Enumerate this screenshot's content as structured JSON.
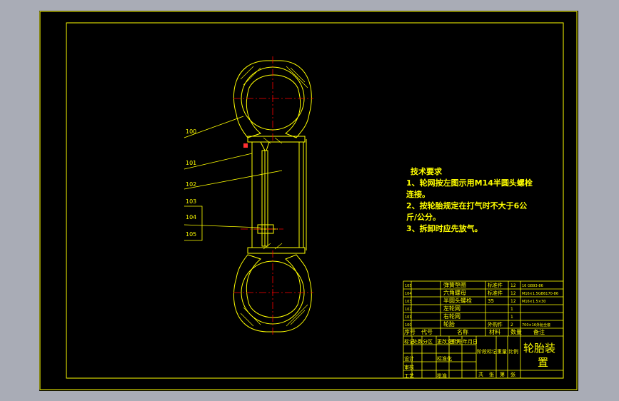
{
  "balloons": [
    "100",
    "101",
    "102",
    "103",
    "104",
    "105"
  ],
  "notes": {
    "title": "技术要求",
    "line1": "1、轮网按左图示用M14半圆头螺栓",
    "line2": "连接。",
    "line3": "2、按轮胎规定在打气时不大于6公",
    "line4": "斤/公分。",
    "line5": "3、拆卸时应先放气。"
  },
  "bom_rows": [
    {
      "no": "105",
      "name": "弹簧垫圈",
      "type": "标准件",
      "qty": "12",
      "spec": "16 GB93-86"
    },
    {
      "no": "104",
      "name": "六角螺母",
      "type": "标准件",
      "qty": "12",
      "spec": "M16×1.5GB6170-86"
    },
    {
      "no": "103",
      "name": "半圆头螺栓",
      "type": "35",
      "qty": "12",
      "spec": "M16×1.5×30"
    },
    {
      "no": "102",
      "name": "左轮网",
      "type": "",
      "qty": "1",
      "spec": ""
    },
    {
      "no": "101",
      "name": "右轮网",
      "type": "",
      "qty": "1",
      "spec": ""
    },
    {
      "no": "100",
      "name": "轮胎",
      "type": "外购件",
      "qty": "2",
      "spec": "700×16外胎全套"
    }
  ],
  "bom_header": {
    "no": "序号",
    "code": "代号",
    "name": "名称",
    "material": "材料",
    "qty": "数量",
    "remark": "备注"
  },
  "title_block": {
    "title_line1": "轮胎装",
    "title_line2": "置",
    "cells": [
      "标记",
      "处数",
      "分区",
      "更改文件号",
      "签字",
      "年月日",
      "设计",
      "标准化",
      "阶段标记",
      "重量",
      "比例",
      "审核",
      "工艺",
      "批准",
      "共",
      "张",
      "第",
      "张"
    ]
  },
  "colors": {
    "background": "#000000",
    "line": "#ffff00",
    "centerline": "#ff0000",
    "frame_outer": "#a9acb6"
  }
}
